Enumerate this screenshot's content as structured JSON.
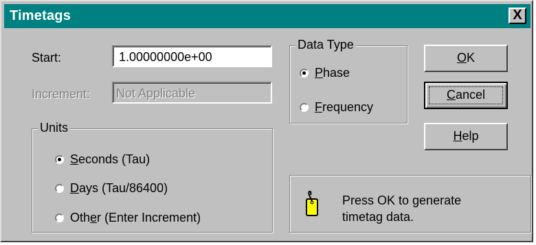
{
  "dialog": {
    "title": "Timetags",
    "close_glyph": "X"
  },
  "start": {
    "label": "Start:",
    "value": "1.00000000e+00"
  },
  "increment": {
    "label": "Increment:",
    "value": "Not Applicable"
  },
  "units": {
    "title": "Units",
    "options": [
      {
        "pre": "",
        "key": "S",
        "post": "econds (Tau)",
        "checked": true
      },
      {
        "pre": "",
        "key": "D",
        "post": "ays (Tau/86400)",
        "checked": false
      },
      {
        "pre": "Oth",
        "key": "e",
        "post": "r (Enter Increment)",
        "checked": false
      }
    ]
  },
  "data_type": {
    "title": "Data Type",
    "options": [
      {
        "pre": "",
        "key": "P",
        "post": "hase",
        "checked": true
      },
      {
        "pre": "",
        "key": "F",
        "post": "requency",
        "checked": false
      }
    ]
  },
  "buttons": {
    "ok": {
      "pre": "",
      "key": "O",
      "post": "K"
    },
    "cancel": {
      "pre": "",
      "key": "C",
      "post": "ancel"
    },
    "help": {
      "pre": "",
      "key": "H",
      "post": "elp"
    }
  },
  "info": {
    "line1": "Press OK to generate",
    "line2": "timetag data.",
    "icon": "tag-icon",
    "icon_color": "#ffff00"
  },
  "colors": {
    "titlebar": "#008080",
    "face": "#c0c0c0"
  }
}
